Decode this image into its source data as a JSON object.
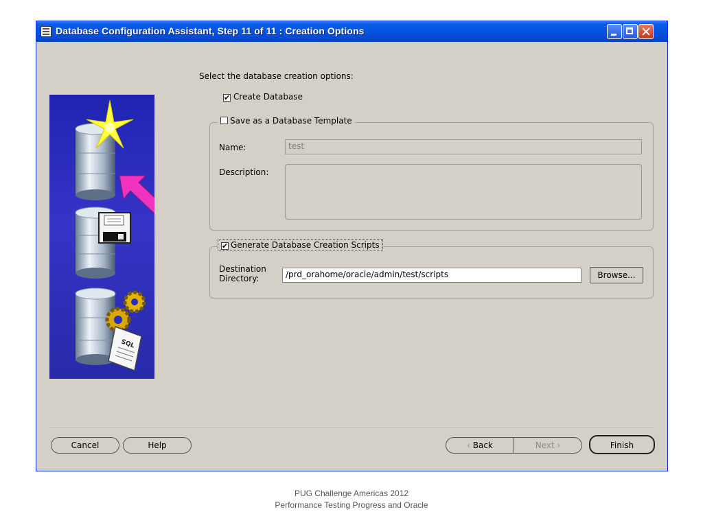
{
  "window": {
    "title": "Database Configuration Assistant, Step 11 of 11 : Creation Options"
  },
  "main": {
    "heading": "Select the database creation options:",
    "create_database": {
      "label": "Create Database",
      "checked": true
    },
    "template_group": {
      "label": "Save as a Database Template",
      "checked": false,
      "name_label": "Name:",
      "name_value": "test",
      "description_label": "Description:",
      "description_value": ""
    },
    "scripts_group": {
      "label": "Generate Database Creation Scripts",
      "checked": true,
      "destination_label_line1": "Destination",
      "destination_label_line2": "Directory:",
      "destination_value": "/prd_orahome/oracle/admin/test/scripts",
      "browse_label": "Browse..."
    }
  },
  "footer": {
    "cancel_label": "Cancel",
    "help_label": "Help",
    "back_label": "Back",
    "next_label": "Next",
    "finish_label": "Finish"
  },
  "art": {
    "sql_label": "SQL"
  },
  "caption": {
    "line1": "PUG Challenge Americas 2012",
    "line2": "Performance Testing Progress and Oracle"
  },
  "colors": {
    "title_bar": "#0652e0",
    "window_bg": "#d4d0c8",
    "art_bg": "#2a2eb8",
    "arrow": "#f032c0",
    "star": "#ffff40"
  }
}
